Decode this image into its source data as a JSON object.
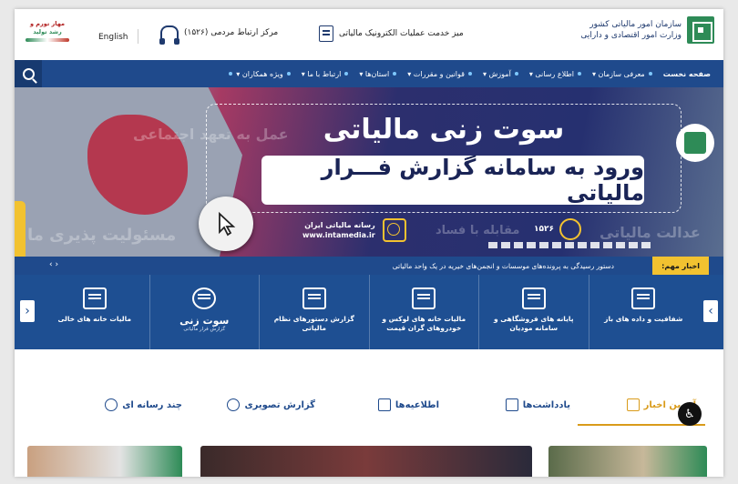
{
  "brand": {
    "name_line1": "سازمان امور مالیاتی کشور",
    "name_line2": "وزارت امور اقتصادی و دارایی"
  },
  "header": {
    "service_desk": "میز خدمت عملیات الکترونیک مالیاتی",
    "call_center": "مرکز ارتباط مردمی (۱۵۲۶)",
    "english": "English",
    "slogan_line1": "مهار تورم و",
    "slogan_line2": "رشد تولید"
  },
  "nav": {
    "items": [
      {
        "label": "صفحه نخست"
      },
      {
        "label": "معرفی سازمان ▾"
      },
      {
        "label": "اطلاع رسانی ▾"
      },
      {
        "label": "آموزش ▾"
      },
      {
        "label": "قوانین و مقررات ▾"
      },
      {
        "label": "استان‌ها ▾"
      },
      {
        "label": "ارتباط با ما ▾"
      },
      {
        "label": "ویژه همکاران ▾"
      }
    ]
  },
  "banner": {
    "headline": "سوت زنی مالیاتی",
    "subheadline": "ورود به سامانه گزارش فـــرار مالیاتی",
    "ghost_left_top": "عمل به تعهد اجتماعی",
    "ghost_left_bottom": "مسئولیت پذیری ما",
    "ghost_mid": "مقابله با فساد",
    "ghost_right": "عدالت مالیاتی",
    "media_line1": "رسانه مالیاتی ایران",
    "media_line2": "www.intamedia.ir",
    "phone": "۱۵۲۶"
  },
  "ticker": {
    "tag": "اخبار مهم:",
    "text": "دستور رسیدگی به پرونده‌های موسسات و انجمن‌های خیریه در یک واحد مالیاتی"
  },
  "services": [
    {
      "label": "شفافیت و داده های باز",
      "sub": ""
    },
    {
      "label": "پایانه های فروشگاهی و سامانه مودیان",
      "sub": ""
    },
    {
      "label": "مالیات خانه های لوکس و خودروهای گران قیمت",
      "sub": ""
    },
    {
      "label": "گزارش دستورهای نظام مالیاتی",
      "sub": ""
    },
    {
      "label": "سوت زنی",
      "sub": "گزارش فرار مالیاتی"
    },
    {
      "label": "مالیات خانه های خالی",
      "sub": ""
    }
  ],
  "tabs": [
    {
      "label": "آخرین اخبار"
    },
    {
      "label": "یادداشت‌ها"
    },
    {
      "label": "اطلاعیه‌ها"
    },
    {
      "label": "گزارش تصویری"
    },
    {
      "label": "چند رسانه ای"
    }
  ],
  "colors": {
    "nav_blue": "#1f4a8c",
    "accent_gold": "#f2c230",
    "brand_green": "#2e8b57"
  },
  "icons": {
    "search": "search-icon",
    "a11y": "accessibility-icon"
  }
}
